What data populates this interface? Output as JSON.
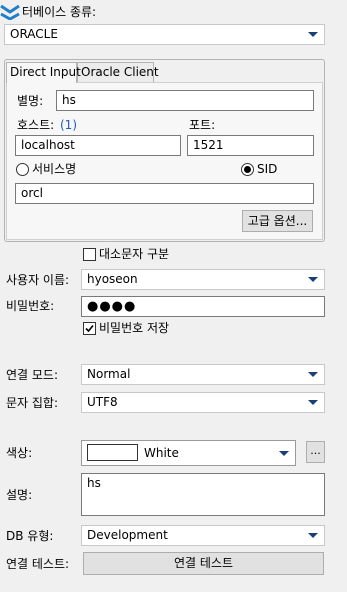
{
  "db_type": {
    "label": "터베이스 종류:",
    "value": "ORACLE"
  },
  "tabs": [
    {
      "label": "Direct Input"
    },
    {
      "label": "Oracle Client"
    }
  ],
  "direct": {
    "alias_label": "별명:",
    "alias_value": "hs",
    "host_label": "호스트:",
    "host_count": "(1)",
    "host_value": "localhost",
    "port_label": "포트:",
    "port_value": "1521",
    "service_label": "서비스명",
    "sid_label": "SID",
    "sid_value": "orcl",
    "advanced_label": "고급 옵션..."
  },
  "case_label": "대소문자 구분",
  "username": {
    "label": "사용자 이름:",
    "value": "hyoseon"
  },
  "password": {
    "label": "비밀번호:",
    "value": "●●●●"
  },
  "save_password_label": "비밀번호 저장",
  "conn_mode": {
    "label": "연결 모드:",
    "value": "Normal"
  },
  "charset": {
    "label": "문자 집합:",
    "value": "UTF8"
  },
  "color": {
    "label": "색상:",
    "value": "White",
    "swatch": "#ffffff",
    "more": "..."
  },
  "description": {
    "label": "설명:",
    "value": "hs"
  },
  "db_purpose": {
    "label": "DB 유형:",
    "value": "Development"
  },
  "test": {
    "label": "연결 테스트:",
    "button": "연결 테스트"
  },
  "colors": {
    "accent": "#1a3e7a",
    "link": "#1f5fbf"
  }
}
